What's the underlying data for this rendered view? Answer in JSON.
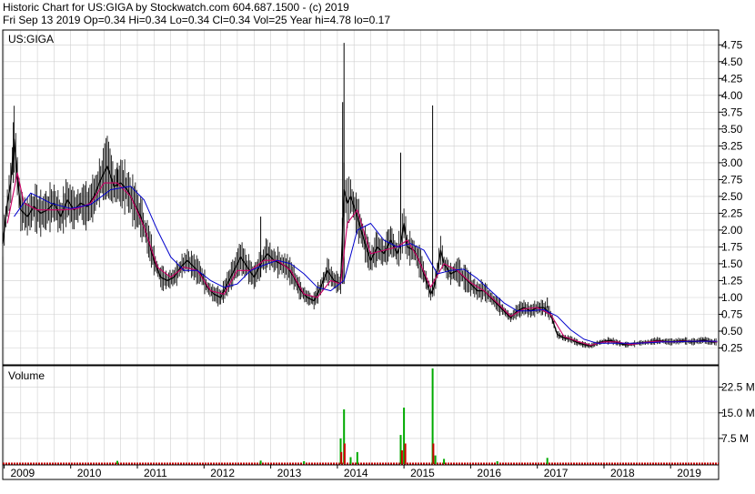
{
  "header": {
    "title": "Historic Chart for US:GIGA by Stockwatch.com 604.687.1500 - (c) 2019",
    "quote": "Fri Sep 13 2019  Op=0.34  Hi=0.34  Lo=0.34  Cl=0.34  Vol=25  Year hi=4.78  lo=0.17"
  },
  "chart_data": [
    {
      "type": "line",
      "title": "US:GIGA",
      "y_ticks": [
        "0.25",
        "0.50",
        "0.75",
        "1.00",
        "1.25",
        "1.50",
        "1.75",
        "2.00",
        "2.25",
        "2.50",
        "2.75",
        "3.00",
        "3.25",
        "3.50",
        "3.75",
        "4.00",
        "4.25",
        "4.50",
        "4.75"
      ],
      "ylim": [
        0,
        4.97
      ],
      "x_ticks": [
        "2009",
        "2010",
        "2011",
        "2012",
        "2013",
        "2014",
        "2015",
        "2016",
        "2017",
        "2018",
        "2019"
      ],
      "x_tick_dates": [
        2009.0,
        2010.0,
        2011.0,
        2012.0,
        2013.0,
        2014.0,
        2015.0,
        2016.0,
        2017.0,
        2018.0,
        2019.0
      ],
      "xlim": [
        2008.98,
        2019.72
      ],
      "grid": true,
      "colors": {
        "price": "#000000",
        "ma_short": "#cc0066",
        "ma_long": "#0000cc",
        "vol_up": "#00aa00",
        "vol_down": "#cc0000"
      },
      "series": [
        {
          "points": [
            [
              2008.98,
              1.8
            ],
            [
              2009.05,
              2.4
            ],
            [
              2009.1,
              2.7
            ],
            [
              2009.15,
              3.35
            ],
            [
              2009.2,
              2.8
            ],
            [
              2009.25,
              2.3
            ],
            [
              2009.35,
              2.2
            ],
            [
              2009.45,
              2.35
            ],
            [
              2009.55,
              2.25
            ],
            [
              2009.65,
              2.3
            ],
            [
              2009.75,
              2.4
            ],
            [
              2009.85,
              2.2
            ],
            [
              2009.95,
              2.45
            ],
            [
              2010.05,
              2.3
            ],
            [
              2010.15,
              2.4
            ],
            [
              2010.25,
              2.35
            ],
            [
              2010.35,
              2.5
            ],
            [
              2010.45,
              2.75
            ],
            [
              2010.55,
              2.95
            ],
            [
              2010.65,
              2.65
            ],
            [
              2010.75,
              2.7
            ],
            [
              2010.85,
              2.6
            ],
            [
              2010.95,
              2.4
            ],
            [
              2011.05,
              2.2
            ],
            [
              2011.15,
              1.9
            ],
            [
              2011.25,
              1.55
            ],
            [
              2011.35,
              1.3
            ],
            [
              2011.45,
              1.25
            ],
            [
              2011.55,
              1.3
            ],
            [
              2011.65,
              1.45
            ],
            [
              2011.75,
              1.55
            ],
            [
              2011.85,
              1.45
            ],
            [
              2011.95,
              1.35
            ],
            [
              2012.05,
              1.15
            ],
            [
              2012.15,
              1.05
            ],
            [
              2012.25,
              1.0
            ],
            [
              2012.35,
              1.2
            ],
            [
              2012.45,
              1.4
            ],
            [
              2012.55,
              1.6
            ],
            [
              2012.65,
              1.45
            ],
            [
              2012.75,
              1.3
            ],
            [
              2012.85,
              1.5
            ],
            [
              2012.95,
              1.65
            ],
            [
              2013.05,
              1.55
            ],
            [
              2013.15,
              1.5
            ],
            [
              2013.25,
              1.45
            ],
            [
              2013.35,
              1.3
            ],
            [
              2013.45,
              1.1
            ],
            [
              2013.55,
              1.0
            ],
            [
              2013.65,
              0.95
            ],
            [
              2013.75,
              1.15
            ],
            [
              2013.85,
              1.4
            ],
            [
              2013.95,
              1.25
            ],
            [
              2014.05,
              1.2
            ],
            [
              2014.1,
              2.6
            ],
            [
              2014.15,
              2.4
            ],
            [
              2014.2,
              2.5
            ],
            [
              2014.3,
              2.2
            ],
            [
              2014.4,
              1.85
            ],
            [
              2014.5,
              1.55
            ],
            [
              2014.6,
              1.75
            ],
            [
              2014.7,
              1.65
            ],
            [
              2014.8,
              1.85
            ],
            [
              2014.9,
              1.65
            ],
            [
              2014.95,
              1.8
            ],
            [
              2015.0,
              2.1
            ],
            [
              2015.05,
              1.75
            ],
            [
              2015.15,
              1.7
            ],
            [
              2015.25,
              1.5
            ],
            [
              2015.35,
              1.2
            ],
            [
              2015.4,
              1.05
            ],
            [
              2015.45,
              1.15
            ],
            [
              2015.5,
              1.4
            ],
            [
              2015.55,
              1.7
            ],
            [
              2015.6,
              1.5
            ],
            [
              2015.7,
              1.35
            ],
            [
              2015.8,
              1.4
            ],
            [
              2015.9,
              1.3
            ],
            [
              2016.0,
              1.2
            ],
            [
              2016.1,
              1.1
            ],
            [
              2016.2,
              1.1
            ],
            [
              2016.3,
              1.0
            ],
            [
              2016.4,
              0.9
            ],
            [
              2016.5,
              0.8
            ],
            [
              2016.6,
              0.7
            ],
            [
              2016.7,
              0.8
            ],
            [
              2016.8,
              0.85
            ],
            [
              2016.9,
              0.8
            ],
            [
              2017.0,
              0.85
            ],
            [
              2017.1,
              0.85
            ],
            [
              2017.2,
              0.75
            ],
            [
              2017.25,
              0.6
            ],
            [
              2017.3,
              0.45
            ],
            [
              2017.4,
              0.4
            ],
            [
              2017.5,
              0.38
            ],
            [
              2017.6,
              0.33
            ],
            [
              2017.7,
              0.3
            ],
            [
              2017.8,
              0.28
            ],
            [
              2017.9,
              0.32
            ],
            [
              2018.0,
              0.35
            ],
            [
              2018.1,
              0.36
            ],
            [
              2018.2,
              0.33
            ],
            [
              2018.3,
              0.3
            ],
            [
              2018.4,
              0.3
            ],
            [
              2018.5,
              0.32
            ],
            [
              2018.6,
              0.33
            ],
            [
              2018.7,
              0.34
            ],
            [
              2018.8,
              0.36
            ],
            [
              2018.9,
              0.35
            ],
            [
              2019.0,
              0.34
            ],
            [
              2019.1,
              0.35
            ],
            [
              2019.2,
              0.36
            ],
            [
              2019.3,
              0.34
            ],
            [
              2019.4,
              0.35
            ],
            [
              2019.5,
              0.37
            ],
            [
              2019.6,
              0.34
            ],
            [
              2019.7,
              0.34
            ]
          ]
        },
        {
          "points": [
            [
              2009.05,
              2.1
            ],
            [
              2009.2,
              2.85
            ],
            [
              2009.3,
              2.4
            ],
            [
              2009.5,
              2.3
            ],
            [
              2009.7,
              2.3
            ],
            [
              2009.9,
              2.3
            ],
            [
              2010.1,
              2.32
            ],
            [
              2010.3,
              2.4
            ],
            [
              2010.5,
              2.7
            ],
            [
              2010.7,
              2.7
            ],
            [
              2010.9,
              2.5
            ],
            [
              2011.1,
              2.05
            ],
            [
              2011.3,
              1.45
            ],
            [
              2011.5,
              1.3
            ],
            [
              2011.7,
              1.45
            ],
            [
              2011.9,
              1.4
            ],
            [
              2012.1,
              1.1
            ],
            [
              2012.3,
              1.05
            ],
            [
              2012.5,
              1.4
            ],
            [
              2012.7,
              1.4
            ],
            [
              2012.9,
              1.55
            ],
            [
              2013.1,
              1.55
            ],
            [
              2013.3,
              1.4
            ],
            [
              2013.5,
              1.05
            ],
            [
              2013.7,
              1.0
            ],
            [
              2013.9,
              1.25
            ],
            [
              2014.05,
              1.2
            ],
            [
              2014.15,
              2.1
            ],
            [
              2014.3,
              2.3
            ],
            [
              2014.5,
              1.65
            ],
            [
              2014.7,
              1.7
            ],
            [
              2014.9,
              1.75
            ],
            [
              2015.05,
              1.85
            ],
            [
              2015.2,
              1.6
            ],
            [
              2015.4,
              1.15
            ],
            [
              2015.6,
              1.5
            ],
            [
              2015.8,
              1.4
            ],
            [
              2016.0,
              1.22
            ],
            [
              2016.2,
              1.1
            ],
            [
              2016.4,
              0.92
            ],
            [
              2016.6,
              0.72
            ],
            [
              2016.8,
              0.83
            ],
            [
              2017.0,
              0.85
            ],
            [
              2017.2,
              0.75
            ],
            [
              2017.4,
              0.42
            ],
            [
              2017.6,
              0.35
            ],
            [
              2017.8,
              0.29
            ],
            [
              2018.0,
              0.34
            ],
            [
              2018.2,
              0.34
            ],
            [
              2018.4,
              0.3
            ],
            [
              2018.6,
              0.33
            ],
            [
              2018.8,
              0.35
            ],
            [
              2019.0,
              0.34
            ],
            [
              2019.2,
              0.35
            ],
            [
              2019.4,
              0.35
            ],
            [
              2019.6,
              0.35
            ],
            [
              2019.7,
              0.34
            ]
          ]
        },
        {
          "points": [
            [
              2009.15,
              2.2
            ],
            [
              2009.4,
              2.55
            ],
            [
              2009.7,
              2.4
            ],
            [
              2010.0,
              2.32
            ],
            [
              2010.3,
              2.38
            ],
            [
              2010.6,
              2.6
            ],
            [
              2010.9,
              2.65
            ],
            [
              2011.1,
              2.45
            ],
            [
              2011.3,
              2.0
            ],
            [
              2011.5,
              1.6
            ],
            [
              2011.7,
              1.4
            ],
            [
              2011.9,
              1.4
            ],
            [
              2012.1,
              1.25
            ],
            [
              2012.3,
              1.15
            ],
            [
              2012.5,
              1.2
            ],
            [
              2012.7,
              1.4
            ],
            [
              2012.9,
              1.48
            ],
            [
              2013.1,
              1.55
            ],
            [
              2013.3,
              1.5
            ],
            [
              2013.5,
              1.35
            ],
            [
              2013.7,
              1.15
            ],
            [
              2013.9,
              1.1
            ],
            [
              2014.1,
              1.25
            ],
            [
              2014.3,
              2.0
            ],
            [
              2014.5,
              2.1
            ],
            [
              2014.7,
              1.85
            ],
            [
              2014.9,
              1.75
            ],
            [
              2015.1,
              1.8
            ],
            [
              2015.3,
              1.7
            ],
            [
              2015.5,
              1.35
            ],
            [
              2015.7,
              1.4
            ],
            [
              2015.9,
              1.42
            ],
            [
              2016.1,
              1.28
            ],
            [
              2016.3,
              1.1
            ],
            [
              2016.5,
              0.92
            ],
            [
              2016.7,
              0.8
            ],
            [
              2016.9,
              0.8
            ],
            [
              2017.1,
              0.82
            ],
            [
              2017.3,
              0.72
            ],
            [
              2017.5,
              0.52
            ],
            [
              2017.7,
              0.38
            ],
            [
              2017.9,
              0.32
            ],
            [
              2018.1,
              0.32
            ],
            [
              2018.3,
              0.32
            ],
            [
              2018.5,
              0.32
            ],
            [
              2018.7,
              0.33
            ],
            [
              2018.9,
              0.34
            ],
            [
              2019.1,
              0.34
            ],
            [
              2019.3,
              0.35
            ],
            [
              2019.5,
              0.35
            ],
            [
              2019.7,
              0.35
            ]
          ]
        }
      ],
      "spikes": [
        [
          2009.14,
          3.6
        ],
        [
          2010.7,
          3.0
        ],
        [
          2012.85,
          2.2
        ],
        [
          2014.08,
          3.9
        ],
        [
          2014.1,
          4.78
        ],
        [
          2014.95,
          3.15
        ],
        [
          2015.43,
          3.85
        ],
        [
          2017.15,
          1.0
        ]
      ]
    },
    {
      "type": "bar",
      "title": "Volume",
      "y_ticks": [
        "7.5 M",
        "15.0 M",
        "22.5 M"
      ],
      "y_tick_values": [
        7.5,
        15.0,
        22.5
      ],
      "ylim": [
        0,
        28
      ],
      "bars": [
        [
          2014.05,
          7.5,
          "up"
        ],
        [
          2014.06,
          3.5,
          "down"
        ],
        [
          2014.1,
          16.0,
          "up"
        ],
        [
          2014.11,
          6.0,
          "down"
        ],
        [
          2014.2,
          2.0,
          "up"
        ],
        [
          2014.3,
          3.5,
          "up"
        ],
        [
          2014.95,
          8.5,
          "up"
        ],
        [
          2014.97,
          4.0,
          "down"
        ],
        [
          2015.0,
          16.5,
          "up"
        ],
        [
          2015.02,
          6.0,
          "down"
        ],
        [
          2015.43,
          28.0,
          "up"
        ],
        [
          2015.44,
          6.0,
          "down"
        ],
        [
          2015.47,
          2.5,
          "up"
        ],
        [
          2015.6,
          1.5,
          "up"
        ],
        [
          2017.15,
          1.8,
          "up"
        ],
        [
          2016.4,
          0.8,
          "up"
        ],
        [
          2013.5,
          0.8,
          "up"
        ],
        [
          2012.85,
          1.0,
          "up"
        ],
        [
          2010.7,
          0.9,
          "up"
        ]
      ]
    }
  ]
}
